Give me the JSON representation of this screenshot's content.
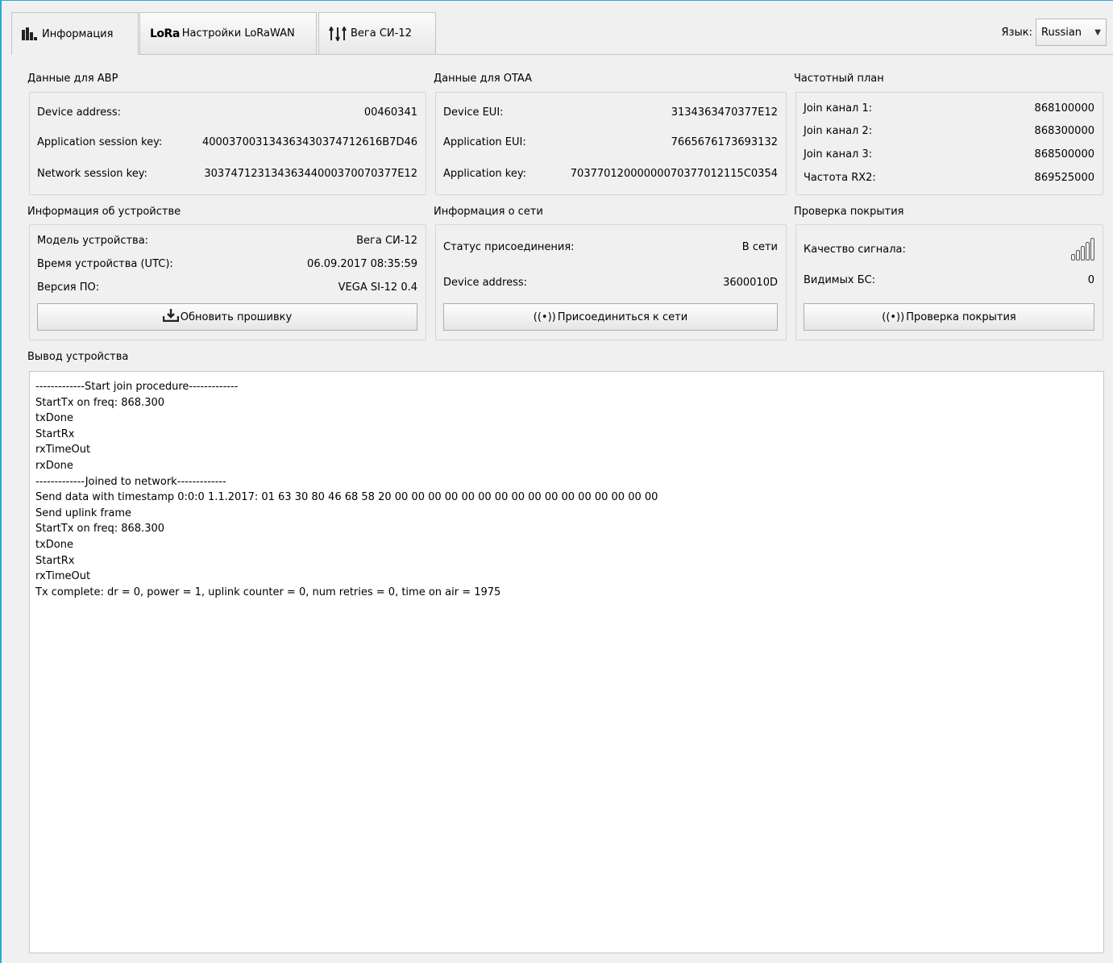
{
  "tabs": [
    {
      "label": "Информация",
      "icon": "bar-chart-icon",
      "active": true
    },
    {
      "label": "Настройки LoRaWAN",
      "icon_text": "LoRa",
      "active": false
    },
    {
      "label": "Вега СИ-12",
      "icon": "sliders-icon",
      "active": false
    }
  ],
  "language": {
    "label": "Язык:",
    "value": "Russian"
  },
  "abp": {
    "title": "Данные для ABP",
    "device_address_label": "Device address:",
    "device_address": "00460341",
    "app_session_key_label": "Application session key:",
    "app_session_key": "400037003134363430374712616B7D46",
    "net_session_key_label": "Network session key:",
    "net_session_key": "30374712313436344000370070377E12"
  },
  "otaa": {
    "title": "Данные для OTAA",
    "device_eui_label": "Device EUI:",
    "device_eui": "3134363470377E12",
    "app_eui_label": "Application EUI:",
    "app_eui": "7665676173693132",
    "app_key_label": "Application key:",
    "app_key": "70377012000000070377012115C0354"
  },
  "freq_plan": {
    "title": "Частотный план",
    "join1_label": "Join канал 1:",
    "join1": "868100000",
    "join2_label": "Join канал 2:",
    "join2": "868300000",
    "join3_label": "Join канал 3:",
    "join3": "868500000",
    "rx2_label": "Частота RX2:",
    "rx2": "869525000"
  },
  "device_info": {
    "title": "Информация об устройстве",
    "model_label": "Модель устройства:",
    "model": "Вега СИ-12",
    "time_label": "Время устройства (UTC):",
    "time": "06.09.2017 08:35:59",
    "fw_label": "Версия ПО:",
    "fw": "VEGA SI-12 0.4",
    "update_button": "Обновить прошивку"
  },
  "network_info": {
    "title": "Информация о сети",
    "status_label": "Статус присоединения:",
    "status": "В сети",
    "address_label": "Device address:",
    "address": "3600010D",
    "join_button": "Присоединиться к сети"
  },
  "coverage": {
    "title": "Проверка покрытия",
    "quality_label": "Качество сигнала:",
    "quality_level": 3,
    "quality_max": 5,
    "visible_bs_label": "Видимых БС:",
    "visible_bs": "0",
    "check_button": "Проверка покрытия"
  },
  "output": {
    "title": "Вывод устройства",
    "lines": [
      "-------------Start join procedure-------------",
      "StartTx on freq: 868.300",
      "txDone",
      "StartRx",
      "rxTimeOut",
      "rxDone",
      "-------------Joined to network-------------",
      "Send data with timestamp 0:0:0 1.1.2017: 01 63 30 80 46 68 58 20 00 00 00 00 00 00 00 00 00 00 00 00 00 00 00 00",
      "Send uplink frame",
      "StartTx on freq: 868.300",
      "txDone",
      "StartRx",
      "rxTimeOut",
      "Tx complete: dr = 0, power = 1, uplink counter = 0, num retries = 0, time on air = 1975"
    ]
  }
}
